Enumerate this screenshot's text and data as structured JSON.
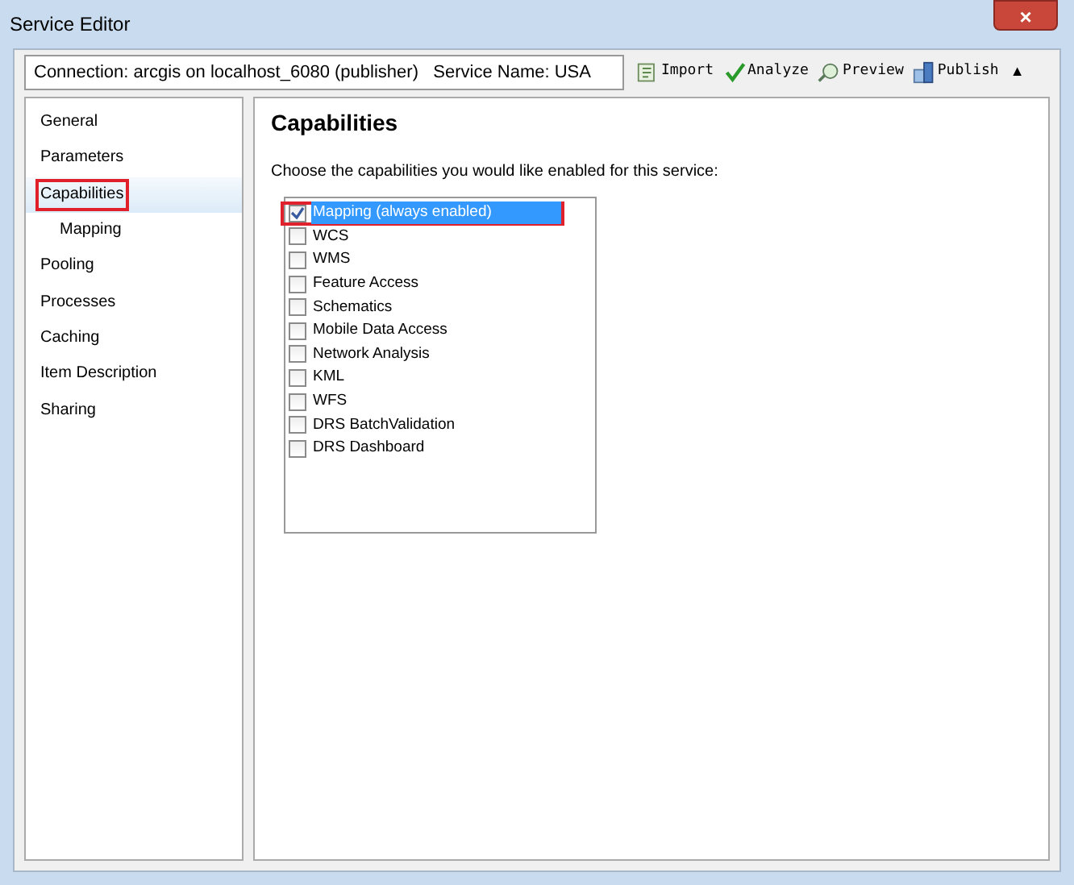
{
  "window": {
    "title": "Service Editor",
    "close": "×"
  },
  "toolbar": {
    "connection": "Connection: arcgis on localhost_6080 (publisher)   Service Name: USA",
    "buttons": [
      {
        "kind": "import",
        "label": "Import"
      },
      {
        "kind": "analyze",
        "label": "Analyze"
      },
      {
        "kind": "preview",
        "label": "Preview"
      },
      {
        "kind": "publish",
        "label": "Publish"
      }
    ],
    "collapse": "▲"
  },
  "sidebar": {
    "items": [
      {
        "label": "General",
        "selected": false,
        "highlighted": false
      },
      {
        "label": "Parameters",
        "selected": false,
        "highlighted": false
      },
      {
        "label": "Capabilities",
        "selected": true,
        "highlighted": true,
        "children": [
          {
            "label": "Mapping",
            "selected": false,
            "highlighted": false
          }
        ]
      },
      {
        "label": "Pooling",
        "selected": false,
        "highlighted": false
      },
      {
        "label": "Processes",
        "selected": false,
        "highlighted": false
      },
      {
        "label": "Caching",
        "selected": false,
        "highlighted": false
      },
      {
        "label": "Item Description",
        "selected": false,
        "highlighted": false
      },
      {
        "label": "Sharing",
        "selected": false,
        "highlighted": false
      }
    ]
  },
  "panel": {
    "title": "Capabilities",
    "instruction": "Choose the capabilities you would like enabled for this service:",
    "capabilities": [
      {
        "label": "Mapping (always enabled)",
        "checked": true,
        "selected": true,
        "highlighted": true
      },
      {
        "label": "WCS",
        "checked": false,
        "selected": false,
        "highlighted": false
      },
      {
        "label": "WMS",
        "checked": false,
        "selected": false,
        "highlighted": false
      },
      {
        "label": "Feature Access",
        "checked": false,
        "selected": false,
        "highlighted": false
      },
      {
        "label": "Schematics",
        "checked": false,
        "selected": false,
        "highlighted": false
      },
      {
        "label": "Mobile Data Access",
        "checked": false,
        "selected": false,
        "highlighted": false
      },
      {
        "label": "Network Analysis",
        "checked": false,
        "selected": false,
        "highlighted": false
      },
      {
        "label": "KML",
        "checked": false,
        "selected": false,
        "highlighted": false
      },
      {
        "label": "WFS",
        "checked": false,
        "selected": false,
        "highlighted": false
      },
      {
        "label": "DRS BatchValidation",
        "checked": false,
        "selected": false,
        "highlighted": false
      },
      {
        "label": "DRS Dashboard",
        "checked": false,
        "selected": false,
        "highlighted": false
      }
    ]
  }
}
